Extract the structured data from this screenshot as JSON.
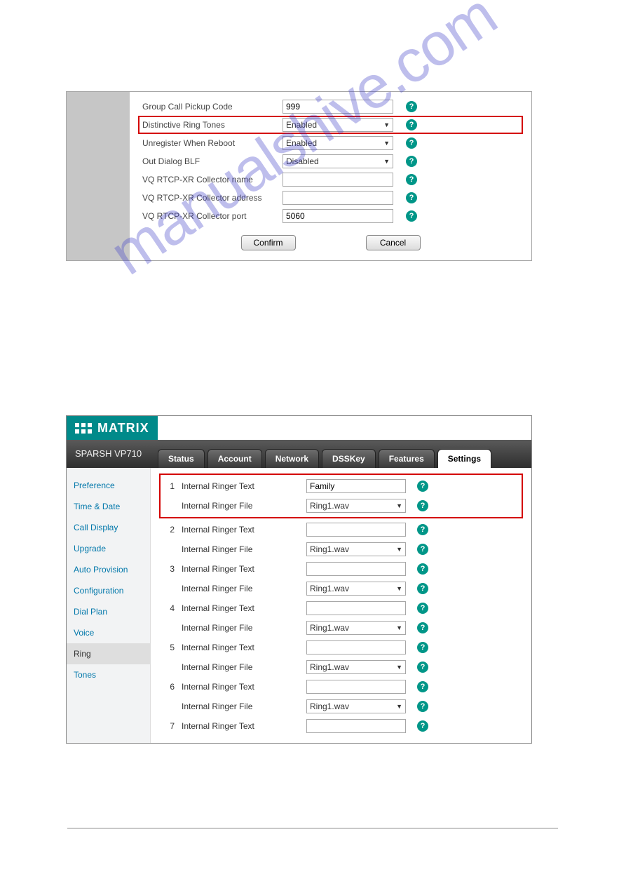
{
  "panel1": {
    "rows": [
      {
        "label": "Group Call Pickup Code",
        "type": "text",
        "value": "999"
      },
      {
        "label": "Distinctive Ring Tones",
        "type": "select",
        "value": "Enabled",
        "highlight": true
      },
      {
        "label": "Unregister When Reboot",
        "type": "select",
        "value": "Enabled"
      },
      {
        "label": "Out Dialog BLF",
        "type": "select",
        "value": "Disabled"
      },
      {
        "label": "VQ RTCP-XR Collector name",
        "type": "text",
        "value": ""
      },
      {
        "label": "VQ RTCP-XR Collector address",
        "type": "text",
        "value": ""
      },
      {
        "label": "VQ RTCP-XR Collector port",
        "type": "text",
        "value": "5060"
      }
    ],
    "confirm": "Confirm",
    "cancel": "Cancel"
  },
  "watermark": "manualshive.com",
  "panel2": {
    "brand": "MATRIX",
    "subtitle": "SPARSH VP710",
    "tabs": [
      "Status",
      "Account",
      "Network",
      "DSSKey",
      "Features",
      "Settings"
    ],
    "activeTab": 5,
    "sidemenu": [
      "Preference",
      "Time & Date",
      "Call Display",
      "Upgrade",
      "Auto Provision",
      "Configuration",
      "Dial Plan",
      "Voice",
      "Ring",
      "Tones"
    ],
    "activeSide": 8,
    "labels": {
      "text": "Internal Ringer Text",
      "file": "Internal Ringer File"
    },
    "ringers": [
      {
        "n": "1",
        "text": "Family",
        "file": "Ring1.wav",
        "highlight": true
      },
      {
        "n": "2",
        "text": "",
        "file": "Ring1.wav"
      },
      {
        "n": "3",
        "text": "",
        "file": "Ring1.wav"
      },
      {
        "n": "4",
        "text": "",
        "file": "Ring1.wav"
      },
      {
        "n": "5",
        "text": "",
        "file": "Ring1.wav"
      },
      {
        "n": "6",
        "text": "",
        "file": "Ring1.wav"
      },
      {
        "n": "7",
        "text": "",
        "file": "",
        "fileHidden": true
      }
    ]
  }
}
